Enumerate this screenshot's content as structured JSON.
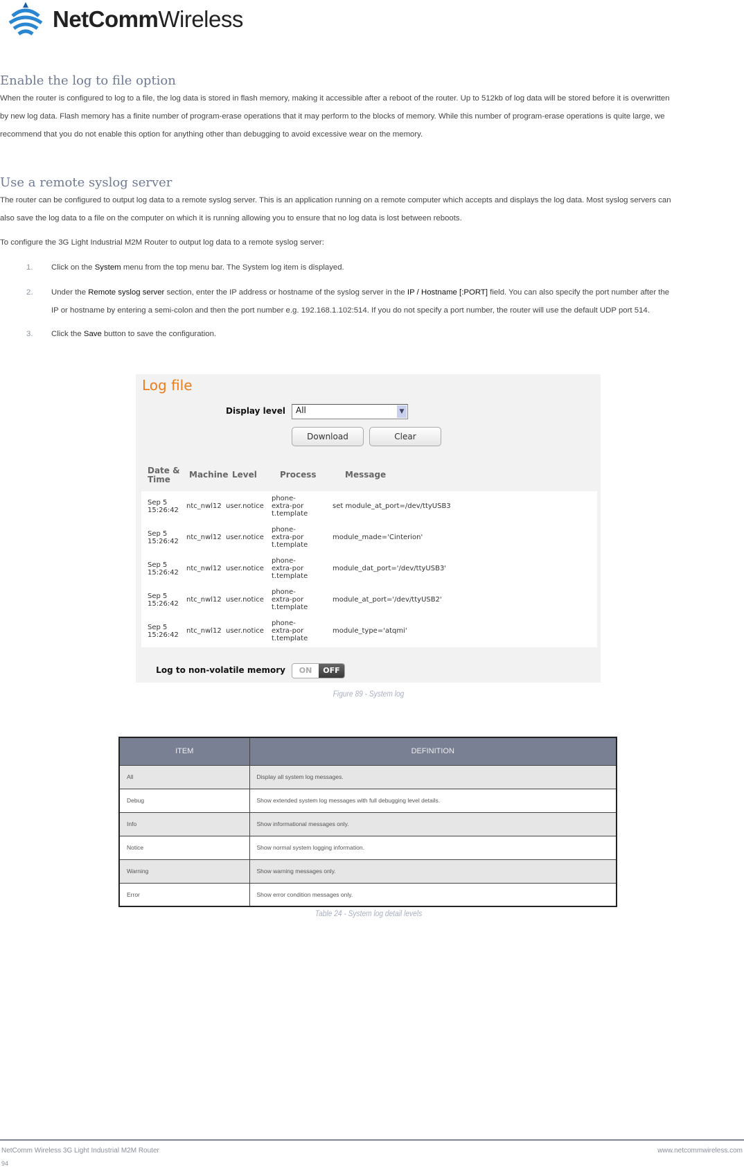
{
  "logo": {
    "brand_bold": "NetComm",
    "brand_light": "Wireless"
  },
  "section1": {
    "heading": "Enable the log to file option",
    "lines": [
      "When the router is configured to log to a file, the log data is stored in flash memory, making it accessible after a reboot of the router. Up to 512kb of log data will be stored before it is overwritten",
      "by new log data. Flash memory has a finite number of program-erase operations that it may perform to the blocks of memory. While this number of program-erase operations is quite large, we",
      "recommend that you do not enable this option for anything other than debugging to avoid excessive wear on the memory."
    ]
  },
  "section2": {
    "heading": "Use a remote syslog server",
    "lines": [
      "The router can be configured to output log data to a remote syslog server. This is an application running on a remote computer which accepts and displays the log data. Most syslog servers can",
      "also save the log data to a file on the computer on which it is running allowing you to ensure that no log data is lost between reboots."
    ],
    "intro": "To configure the 3G Light Industrial M2M Router to output log data to a remote syslog server:",
    "steps": [
      {
        "num": "1.",
        "a": "Click on the ",
        "b": "System",
        "c": " menu from the top menu bar. The System log item is displayed."
      },
      {
        "num": "2.",
        "a": "Under the ",
        "b": "Remote syslog server",
        "c": " section, enter the IP address or hostname of the syslog server in the ",
        "d": "IP / Hostname [:PORT]",
        "e": " field. You can also specify the port number after the",
        "f": "IP or hostname by entering a semi-colon and then the port number e.g. 192.168.1.102:514. If you do not specify a port number, the router will use the default UDP port 514."
      },
      {
        "num": "3.",
        "a": "Click the ",
        "b": "Save",
        "c": " button to save the configuration."
      }
    ]
  },
  "logfile": {
    "title": "Log file",
    "display_level_label": "Display level",
    "display_level_value": "All",
    "download_label": "Download",
    "clear_label": "Clear",
    "headers": [
      "Date & Time",
      "Machine",
      "Level",
      "Process",
      "Message"
    ],
    "rows": [
      {
        "date": "Sep 5",
        "time": "15:26:42",
        "machine": "ntc_nwl12",
        "level": "user.notice",
        "p1": "phone-",
        "p2": "extra-por",
        "p3": "t.template",
        "message": "set module_at_port=/dev/ttyUSB3"
      },
      {
        "date": "Sep 5",
        "time": "15:26:42",
        "machine": "ntc_nwl12",
        "level": "user.notice",
        "p1": "phone-",
        "p2": "extra-por",
        "p3": "t.template",
        "message": "module_made='Cinterion'"
      },
      {
        "date": "Sep 5",
        "time": "15:26:42",
        "machine": "ntc_nwl12",
        "level": "user.notice",
        "p1": "phone-",
        "p2": "extra-por",
        "p3": "t.template",
        "message": "module_dat_port='/dev/ttyUSB3'"
      },
      {
        "date": "Sep 5",
        "time": "15:26:42",
        "machine": "ntc_nwl12",
        "level": "user.notice",
        "p1": "phone-",
        "p2": "extra-por",
        "p3": "t.template",
        "message": "module_at_port='/dev/ttyUSB2'"
      },
      {
        "date": "Sep 5",
        "time": "15:26:42",
        "machine": "ntc_nwl12",
        "level": "user.notice",
        "p1": "phone-",
        "p2": "extra-por",
        "p3": "t.template",
        "message": "module_type='atqmi'"
      }
    ],
    "nvm_label": "Log to non-volatile memory",
    "toggle_on": "ON",
    "toggle_off": "OFF",
    "toggle_state": "OFF"
  },
  "figure_caption": "Figure 89 - System log",
  "def_table": {
    "headers": [
      "ITEM",
      "DEFINITION"
    ],
    "rows": [
      [
        "All",
        "Display all system log messages."
      ],
      [
        "Debug",
        "Show extended system log messages with full debugging level details."
      ],
      [
        "Info",
        "Show informational messages only."
      ],
      [
        "Notice",
        "Show normal system logging information."
      ],
      [
        "Warning",
        "Show warning messages only."
      ],
      [
        "Error",
        "Show error condition messages only."
      ]
    ],
    "caption": "Table 24 - System log detail levels"
  },
  "footer": {
    "left": "NetComm Wireless 3G Light Industrial M2M Router",
    "right": "www.netcommwireless.com",
    "page": "94"
  },
  "colors": {
    "heading": "#6e7a93",
    "accent_orange": "#f07d1a",
    "table_header": "#7a8094"
  }
}
